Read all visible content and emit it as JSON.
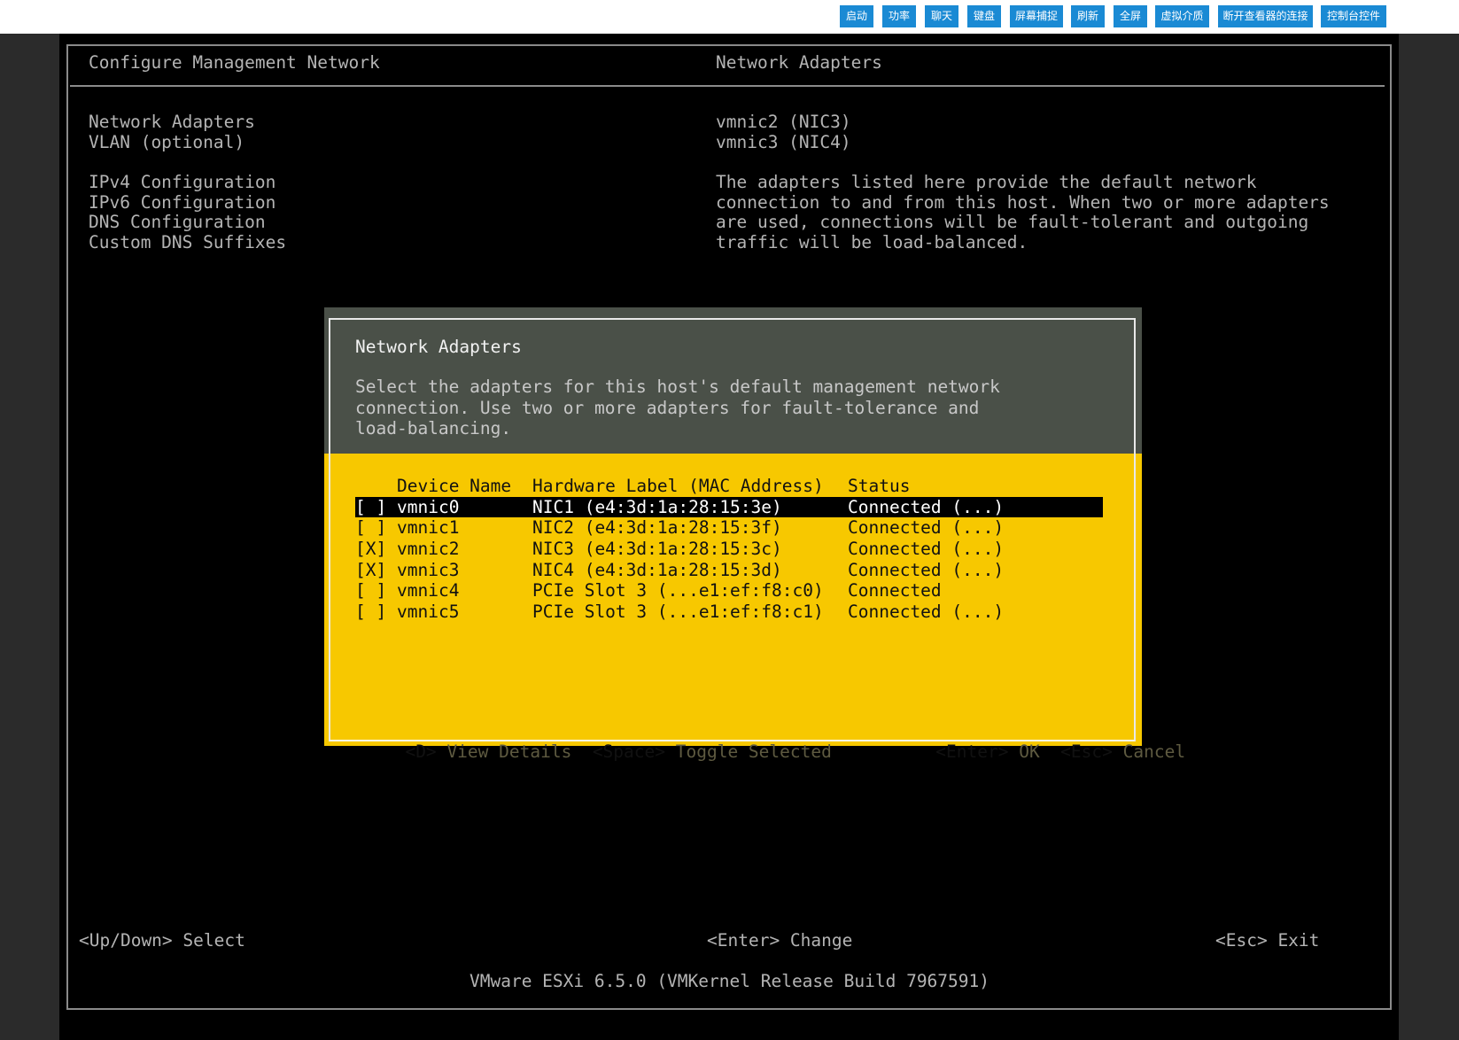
{
  "toolbar": {
    "buttons": [
      "启动",
      "功率",
      "聊天",
      "键盘",
      "屏幕捕捉",
      "刷新",
      "全屏",
      "虚拟介质",
      "断开查看器的连接",
      "控制台控件"
    ]
  },
  "console": {
    "left_title": "Configure Management Network",
    "right_title": "Network Adapters",
    "menu": [
      "Network Adapters",
      "VLAN (optional)",
      "IPv4 Configuration",
      "IPv6 Configuration",
      "DNS Configuration",
      "Custom DNS Suffixes"
    ],
    "adapters": [
      "vmnic2 (NIC3)",
      "vmnic3 (NIC4)"
    ],
    "help_lines": [
      "The adapters listed here provide the default network",
      "connection to and from this host. When two or more adapters",
      "are used, connections will be fault-tolerant and outgoing",
      "traffic will be load-balanced."
    ],
    "footer": {
      "select": "<Up/Down> Select",
      "change": "<Enter> Change",
      "exit": "<Esc> Exit"
    },
    "version": "VMware ESXi 6.5.0 (VMKernel Release Build 7967591)"
  },
  "dialog": {
    "title": "Network Adapters",
    "description": [
      "Select the adapters for this host's default management network",
      "connection. Use two or more adapters for fault-tolerance and",
      "load-balancing."
    ],
    "columns": [
      "Device Name",
      "Hardware Label (MAC Address)",
      "Status"
    ],
    "rows": [
      {
        "check": "[ ]",
        "device": "vmnic0",
        "hw": "NIC1 (e4:3d:1a:28:15:3e)",
        "status": "Connected (...)",
        "selected": true
      },
      {
        "check": "[ ]",
        "device": "vmnic1",
        "hw": "NIC2 (e4:3d:1a:28:15:3f)",
        "status": "Connected (...)",
        "selected": false
      },
      {
        "check": "[X]",
        "device": "vmnic2",
        "hw": "NIC3 (e4:3d:1a:28:15:3c)",
        "status": "Connected (...)",
        "selected": false
      },
      {
        "check": "[X]",
        "device": "vmnic3",
        "hw": "NIC4 (e4:3d:1a:28:15:3d)",
        "status": "Connected (...)",
        "selected": false
      },
      {
        "check": "[ ]",
        "device": "vmnic4",
        "hw": "PCIe Slot 3 (...e1:ef:f8:c0)",
        "status": "Connected",
        "selected": false
      },
      {
        "check": "[ ]",
        "device": "vmnic5",
        "hw": "PCIe Slot 3 (...e1:ef:f8:c1)",
        "status": "Connected (...)",
        "selected": false
      }
    ],
    "keys": {
      "details_key": "<D>",
      "details_label": "View Details",
      "toggle_key": "<Space>",
      "toggle_label": "Toggle Selected",
      "ok_key": "<Enter>",
      "ok_label": "OK",
      "cancel_key": "<Esc>",
      "cancel_label": "Cancel"
    }
  }
}
